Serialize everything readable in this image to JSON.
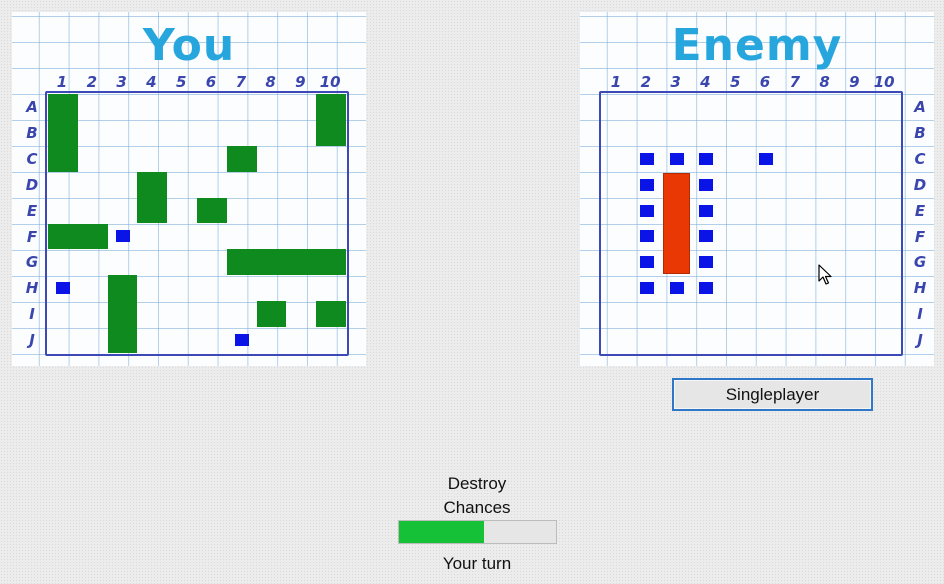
{
  "player_board": {
    "title": "You",
    "columns": [
      "1",
      "2",
      "3",
      "4",
      "5",
      "6",
      "7",
      "8",
      "9",
      "10"
    ],
    "rows": [
      "A",
      "B",
      "C",
      "D",
      "E",
      "F",
      "G",
      "H",
      "I",
      "J"
    ],
    "ships": [
      {
        "from": "A1",
        "to": "C1"
      },
      {
        "from": "A10",
        "to": "B10"
      },
      {
        "from": "C7",
        "to": "C7"
      },
      {
        "from": "D4",
        "to": "E4"
      },
      {
        "from": "E6",
        "to": "E6"
      },
      {
        "from": "F1",
        "to": "F2"
      },
      {
        "from": "G7",
        "to": "G10"
      },
      {
        "from": "H3",
        "to": "J3"
      },
      {
        "from": "I8",
        "to": "I8"
      },
      {
        "from": "I10",
        "to": "I10"
      }
    ],
    "misses": [
      "F3",
      "H1",
      "J7"
    ],
    "colors": {
      "ship": "#0f8a1e",
      "miss": "#0a14e6"
    }
  },
  "enemy_board": {
    "title": "Enemy",
    "columns": [
      "1",
      "2",
      "3",
      "4",
      "5",
      "6",
      "7",
      "8",
      "9",
      "10"
    ],
    "rows": [
      "A",
      "B",
      "C",
      "D",
      "E",
      "F",
      "G",
      "H",
      "I",
      "J"
    ],
    "destroyed_ships": [
      {
        "from": "D3",
        "to": "G3"
      }
    ],
    "misses": [
      "C2",
      "C3",
      "C4",
      "C6",
      "D2",
      "D4",
      "E2",
      "E4",
      "F2",
      "F4",
      "G2",
      "G4",
      "H2",
      "H3",
      "H4"
    ],
    "colors": {
      "destroyed": "#ea3805",
      "miss": "#0a14e6"
    }
  },
  "controls": {
    "singleplayer_label": "Singleplayer"
  },
  "status": {
    "destroy_label_line1": "Destroy",
    "destroy_label_line2": "Chances",
    "progress_fraction": 0.54,
    "progress_color": "#14c137",
    "turn_text": "Your turn"
  },
  "icons": {
    "cursor": "mouse-pointer-icon"
  }
}
